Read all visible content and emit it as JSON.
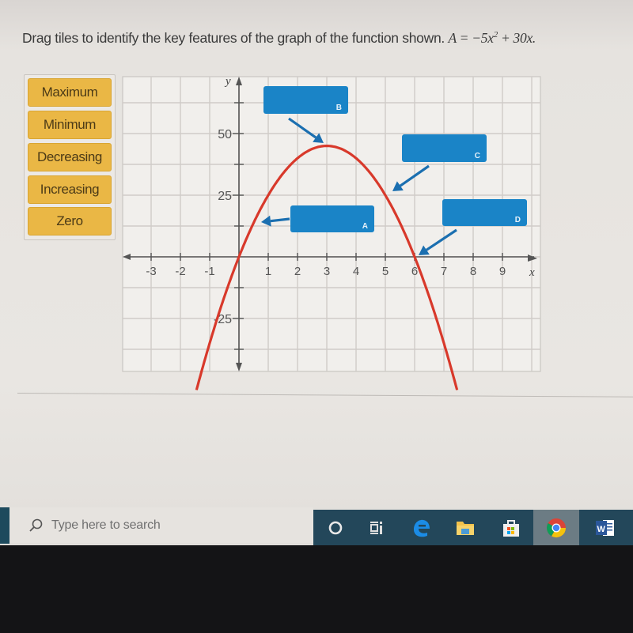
{
  "question": {
    "prompt": "Drag tiles to identify the key features of the graph of the function shown.",
    "equation_prefix": "A = −5x",
    "equation_exp": "2",
    "equation_suffix": " + 30x."
  },
  "tiles": [
    {
      "label": "Maximum"
    },
    {
      "label": "Minimum"
    },
    {
      "label": "Decreasing"
    },
    {
      "label": "Increasing"
    },
    {
      "label": "Zero"
    }
  ],
  "drop_zones": [
    {
      "id": "A",
      "label": "A",
      "value": ""
    },
    {
      "id": "B",
      "label": "B",
      "value": ""
    },
    {
      "id": "C",
      "label": "C",
      "value": ""
    },
    {
      "id": "D",
      "label": "D",
      "value": ""
    }
  ],
  "chart_data": {
    "type": "line",
    "function": "A = -5x^2 + 30x",
    "xlabel": "x",
    "ylabel": "y",
    "xlim": [
      -4,
      10
    ],
    "ylim": [
      -45,
      70
    ],
    "x_ticks": [
      -3,
      -2,
      -1,
      1,
      2,
      3,
      4,
      5,
      6,
      7,
      8,
      9
    ],
    "y_tick_labels": [
      {
        "value": 50,
        "label": "50"
      },
      {
        "value": 25,
        "label": "25"
      },
      {
        "value": -25,
        "label": "-25"
      }
    ],
    "y_ticks_unlabeled": [
      62.5,
      37.5,
      12.5,
      -12.5,
      -37.5
    ],
    "grid": true,
    "series": [
      {
        "name": "A(x)",
        "color": "#d8392b",
        "x_range": [
          -1.45,
          7.45
        ]
      }
    ],
    "key_points": [
      {
        "name": "vertex",
        "x": 3,
        "y": 45
      },
      {
        "name": "zero-1",
        "x": 0,
        "y": 0
      },
      {
        "name": "zero-2",
        "x": 6,
        "y": 0
      }
    ]
  },
  "colors": {
    "tile": "#eab745",
    "drop_zone": "#1a84c7",
    "curve": "#d8392b",
    "arrow": "#1b6fb0"
  },
  "taskbar": {
    "search_placeholder": "Type here to search",
    "apps": [
      {
        "name": "cortana",
        "active": false
      },
      {
        "name": "task-view",
        "active": false
      },
      {
        "name": "edge",
        "active": false
      },
      {
        "name": "file-explorer",
        "active": false
      },
      {
        "name": "store",
        "active": false
      },
      {
        "name": "chrome",
        "active": true
      },
      {
        "name": "word",
        "active": false,
        "open": true
      }
    ]
  }
}
